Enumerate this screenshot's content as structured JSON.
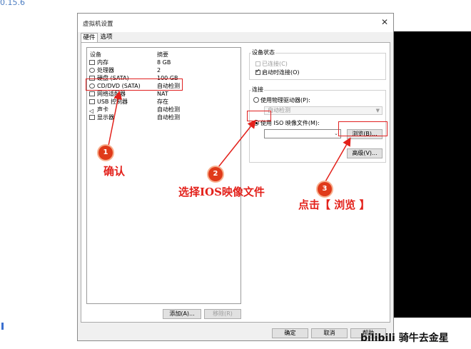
{
  "header": {
    "version_text": "0.15.6"
  },
  "dialog": {
    "title": "虚拟机设置",
    "close_glyph": "✕",
    "tabs": [
      {
        "label": "硬件"
      },
      {
        "label": "选项"
      }
    ],
    "devices": {
      "col_device": "设备",
      "col_summary": "摘要",
      "rows": [
        {
          "name": "内存",
          "summary": "8 GB",
          "icon": "memory-icon"
        },
        {
          "name": "处理器",
          "summary": "2",
          "icon": "cpu-icon"
        },
        {
          "name": "硬盘 (SATA)",
          "summary": "100 GB",
          "icon": "disk-icon"
        },
        {
          "name": "CD/DVD (SATA)",
          "summary": "自动检测",
          "icon": "cd-icon"
        },
        {
          "name": "网络适配器",
          "summary": "NAT",
          "icon": "network-icon"
        },
        {
          "name": "USB 控制器",
          "summary": "存在",
          "icon": "usb-icon"
        },
        {
          "name": "声卡",
          "summary": "自动检测",
          "icon": "sound-icon"
        },
        {
          "name": "显示器",
          "summary": "自动检测",
          "icon": "monitor-icon"
        }
      ],
      "add_button": "添加(A)...",
      "remove_button": "移除(R)"
    },
    "device_status": {
      "label": "设备状态",
      "connected": "已连接(C)",
      "connect_on_power": "启动时连接(O)"
    },
    "connection": {
      "label": "连接",
      "use_physical": "使用物理驱动器(P):",
      "physical_value": "自动检测",
      "use_iso": "使用 ISO 映像文件(M):",
      "iso_value": "",
      "browse_button": "浏览(B)...",
      "advanced_button": "高级(V)..."
    },
    "footer": {
      "ok": "确定",
      "cancel": "取消",
      "help": "帮助"
    }
  },
  "annotations": [
    {
      "num": "1",
      "text": "确认"
    },
    {
      "num": "2",
      "text": "选择IOS映像文件"
    },
    {
      "num": "3",
      "text": "点击【 浏览 】"
    }
  ],
  "watermark": "bilibili 骑牛去金星",
  "colors": {
    "annotation": "#e3211b",
    "badge": "#e03a1a"
  }
}
